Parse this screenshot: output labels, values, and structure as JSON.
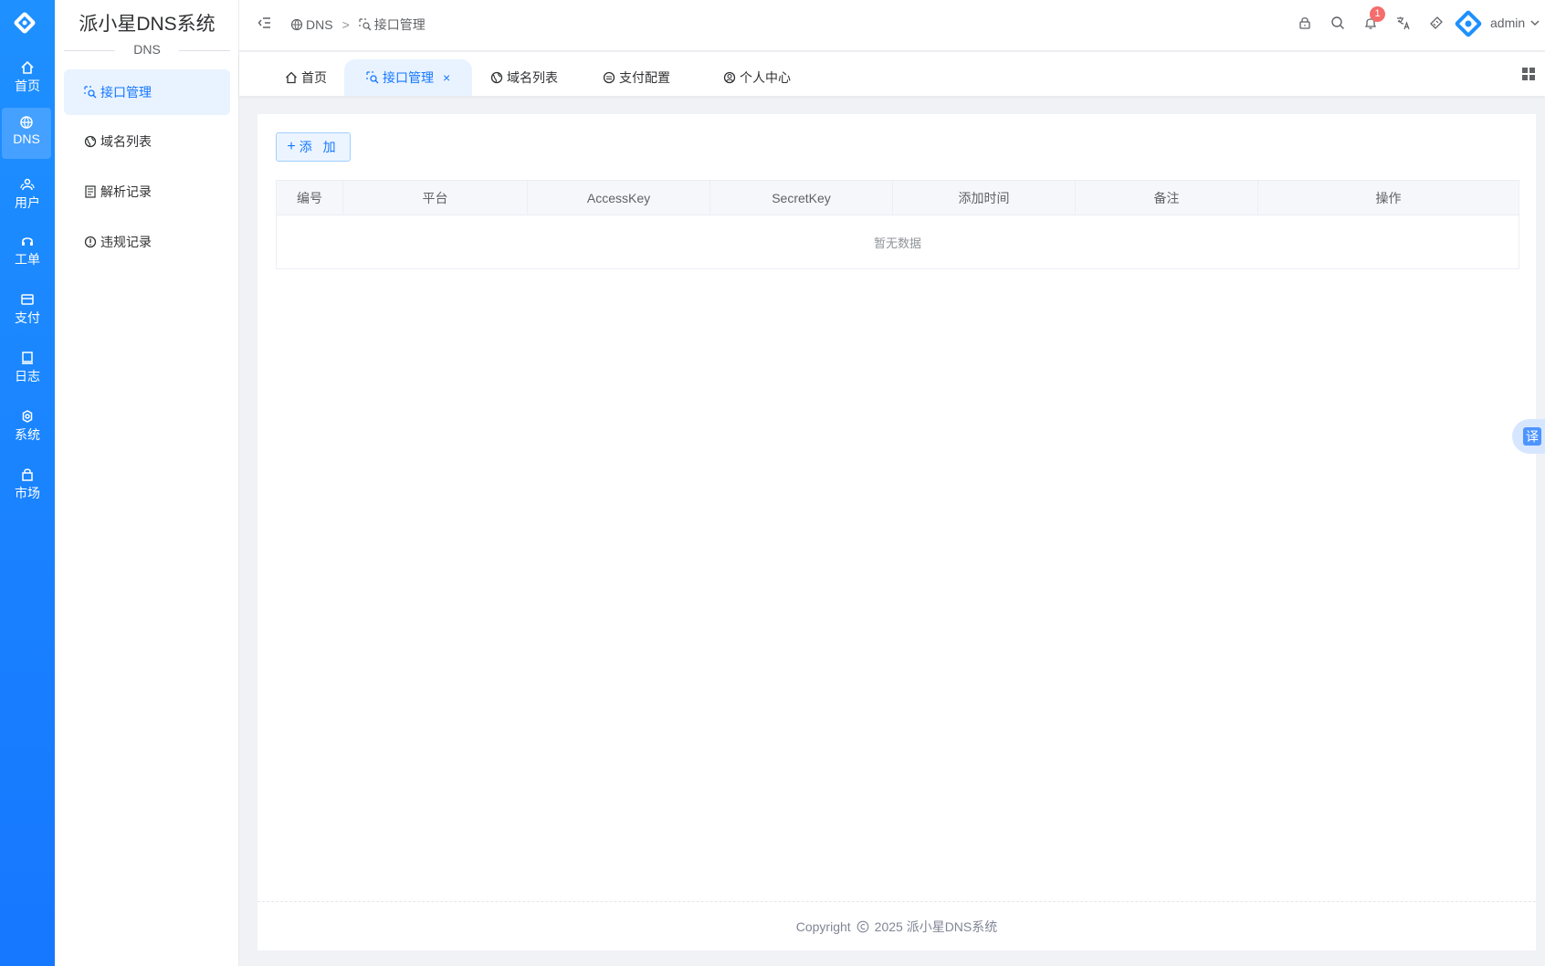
{
  "rail": {
    "items": [
      {
        "label": "首页",
        "icon": "home-icon"
      },
      {
        "label": "DNS",
        "icon": "globe-icon"
      },
      {
        "label": "用户",
        "icon": "users-icon"
      },
      {
        "label": "工单",
        "icon": "headset-icon"
      },
      {
        "label": "支付",
        "icon": "wallet-icon"
      },
      {
        "label": "日志",
        "icon": "notebook-icon"
      },
      {
        "label": "系统",
        "icon": "gear-icon"
      },
      {
        "label": "市场",
        "icon": "bag-icon"
      }
    ]
  },
  "sidebar": {
    "title": "派小星DNS系统",
    "subtitle": "DNS",
    "items": [
      {
        "label": "接口管理",
        "icon": "api-icon"
      },
      {
        "label": "域名列表",
        "icon": "globe-icon"
      },
      {
        "label": "解析记录",
        "icon": "document-icon"
      },
      {
        "label": "违规记录",
        "icon": "warning-icon"
      }
    ]
  },
  "header": {
    "breadcrumb": [
      "DNS",
      "接口管理"
    ],
    "breadcrumb_sep": ">",
    "notification_count": "1",
    "username": "admin"
  },
  "tabs": [
    {
      "label": "首页",
      "icon": "home-icon"
    },
    {
      "label": "接口管理",
      "icon": "api-icon",
      "close": "×"
    },
    {
      "label": "域名列表",
      "icon": "globe-icon"
    },
    {
      "label": "支付配置",
      "icon": "wallet-icon"
    },
    {
      "label": "个人中心",
      "icon": "user-icon"
    }
  ],
  "main": {
    "add_button": "添 加",
    "add_button_icon": "+",
    "table": {
      "headers": [
        "编号",
        "平台",
        "AccessKey",
        "SecretKey",
        "添加时间",
        "备注",
        "操作"
      ],
      "empty_text": "暂无数据"
    },
    "footer": {
      "copyright_label": "Copyright",
      "year_text": "2025 派小星DNS系统"
    }
  },
  "translate_label": "译",
  "colors": {
    "accent": "#1677ff",
    "badge": "#f56c6c"
  }
}
